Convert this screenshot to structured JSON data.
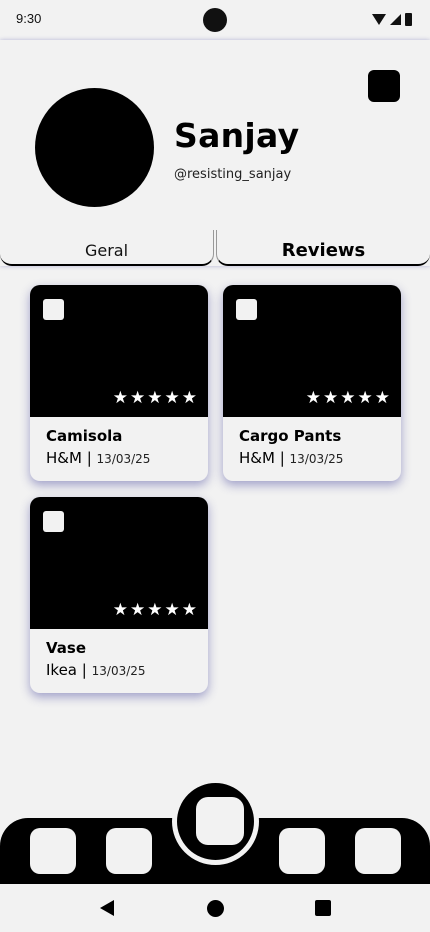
{
  "status": {
    "time": "9:30"
  },
  "profile": {
    "name": "Sanjay",
    "handle": "@resisting_sanjay"
  },
  "tabs": [
    {
      "label": "Geral",
      "active": false
    },
    {
      "label": "Reviews",
      "active": true
    }
  ],
  "reviews": [
    {
      "title": "Camisola",
      "brand": "H&M",
      "separator": "|",
      "date": "13/03/25",
      "rating": 5
    },
    {
      "title": "Cargo Pants",
      "brand": "H&M",
      "separator": "|",
      "date": "13/03/25",
      "rating": 5
    },
    {
      "title": "Vase",
      "brand": "Ikea",
      "separator": "|",
      "date": "13/03/25",
      "rating": 5
    }
  ],
  "icons": {
    "star": "★",
    "settings": "settings-icon",
    "back": "back-icon",
    "home": "home-icon",
    "recent": "recent-apps-icon"
  },
  "colors": {
    "background": "#f2f2f2",
    "primary": "#000000",
    "shadow": "#3c3c96"
  }
}
